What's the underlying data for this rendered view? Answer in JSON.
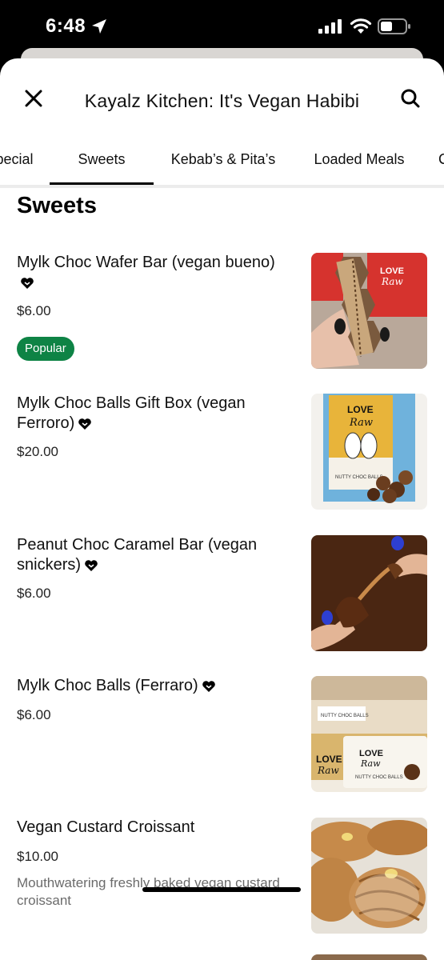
{
  "status_bar": {
    "time": "6:48"
  },
  "header": {
    "title": "Kayalz Kitchen: It's Vegan Habibi"
  },
  "tabs": [
    {
      "label": "Special"
    },
    {
      "label": "Sweets"
    },
    {
      "label": "Kebab’s & Pita’s"
    },
    {
      "label": "Loaded Meals"
    },
    {
      "label": "C"
    }
  ],
  "section": {
    "title": "Sweets"
  },
  "items": [
    {
      "name": "Mylk Choc Wafer Bar (vegan bueno)",
      "price": "$6.00",
      "badge": "Popular"
    },
    {
      "name": "Mylk Choc Balls Gift Box (vegan Ferroro)",
      "price": "$20.00"
    },
    {
      "name": "Peanut Choc Caramel Bar (vegan snickers)",
      "price": "$6.00"
    },
    {
      "name": "Mylk Choc Balls (Ferraro)",
      "price": "$6.00"
    },
    {
      "name": "Vegan Custard Croissant",
      "price": "$10.00",
      "description": "Mouthwatering freshly baked vegan custard croissant"
    }
  ],
  "image_text": {
    "brand_line1": "LOVE",
    "brand_line2": "Raw",
    "nutty_choc_balls": "NUTTY CHOC BALLS"
  }
}
